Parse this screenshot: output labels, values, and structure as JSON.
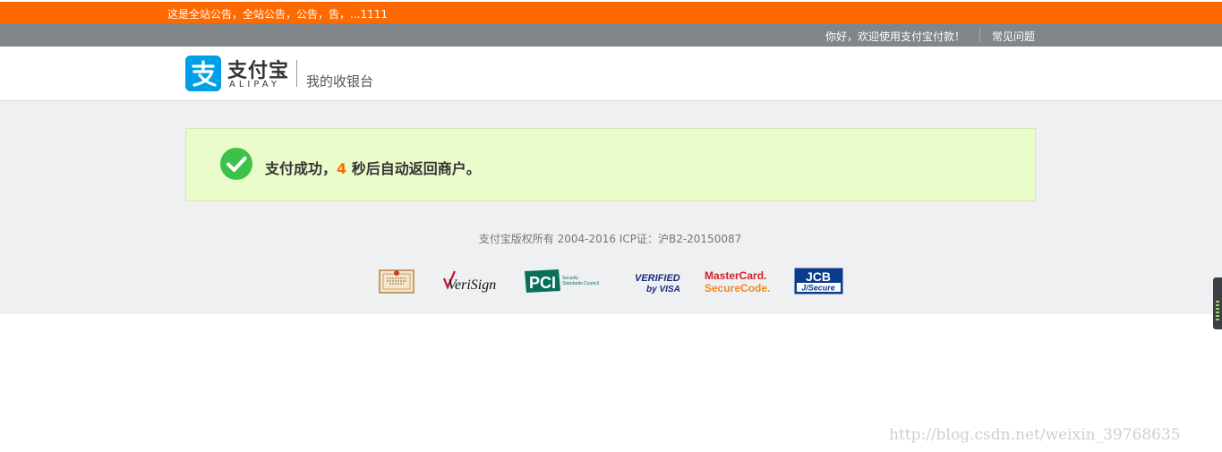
{
  "notice": {
    "text": "这是全站公告，全站公告，公告，告，...1111"
  },
  "top_nav": {
    "welcome": "你好，欢迎使用支付宝付款！",
    "faq": "常见问题"
  },
  "header": {
    "logo_text": "支付宝",
    "logo_sub": "ALIPAY",
    "title": "我的收银台"
  },
  "success": {
    "prefix": "支付成功，",
    "countdown": "4",
    "suffix": " 秒后自动返回商户。"
  },
  "footer": {
    "copyright": "支付宝版权所有 2004-2016 ICP证：沪B2-20150087",
    "badges": [
      {
        "name": "verisign",
        "label": "VeriSign"
      },
      {
        "name": "pci",
        "label": "PCI",
        "sub": "Security Standards Council"
      },
      {
        "name": "verified-by-visa",
        "line1": "VERIFIED",
        "line2": "by VISA"
      },
      {
        "name": "mastercard",
        "line1": "MasterCard.",
        "line2": "SecureCode."
      },
      {
        "name": "jcb",
        "line1": "JCB",
        "line2": "J/Secure"
      }
    ]
  },
  "watermark": "http://blog.csdn.net/weixin_39768635",
  "colors": {
    "notice_bg": "#ff6a00",
    "nav_bg": "#80868a",
    "brand_blue": "#00a0e9",
    "success_bg": "#ebfccb",
    "success_green": "#3cc248",
    "accent_orange": "#ff6a00"
  }
}
